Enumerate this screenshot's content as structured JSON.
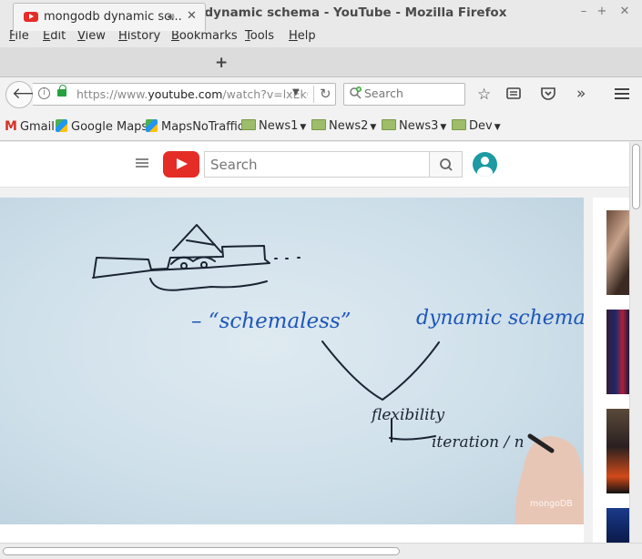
{
  "window": {
    "title": "mongodb dynamic schema - YouTube - Mozilla Firefox",
    "minimize": "–",
    "maximize": "+",
    "close": "✕"
  },
  "menu": [
    "File",
    "Edit",
    "View",
    "History",
    "Bookmarks",
    "Tools",
    "Help"
  ],
  "menu_access_keys": [
    "F",
    "E",
    "V",
    "H",
    "B",
    "T",
    "H"
  ],
  "tab": {
    "label": "mongodb dynamic sc...",
    "audio_icon": "speaker-icon",
    "close": "✕",
    "new_tab": "+"
  },
  "nav": {
    "url_dim": "https://www.",
    "url_host": "youtube.com",
    "url_rest": "/watch?v=lxEk0",
    "search_placeholder": "Search"
  },
  "bookmarks": [
    {
      "label": "Gmail",
      "icon": "gmail-icon"
    },
    {
      "label": "Google Maps",
      "icon": "maps-icon"
    },
    {
      "label": "MapsNoTraffic",
      "icon": "maps-icon"
    },
    {
      "label": "News1",
      "icon": "folder-icon",
      "menu": true
    },
    {
      "label": "News2",
      "icon": "folder-icon",
      "menu": true
    },
    {
      "label": "News3",
      "icon": "folder-icon",
      "menu": true
    },
    {
      "label": "Dev",
      "icon": "folder-icon",
      "menu": true
    }
  ],
  "youtube": {
    "search_placeholder": "Search",
    "brand_color": "#e52d27",
    "avatar_color": "#1d9aa2"
  },
  "video": {
    "whiteboard_text": {
      "quote": "– “schemaless”",
      "right": "dynamic schema",
      "center": "flexibility",
      "bottom": "iteration / n"
    },
    "watermark": "mongoDB"
  }
}
